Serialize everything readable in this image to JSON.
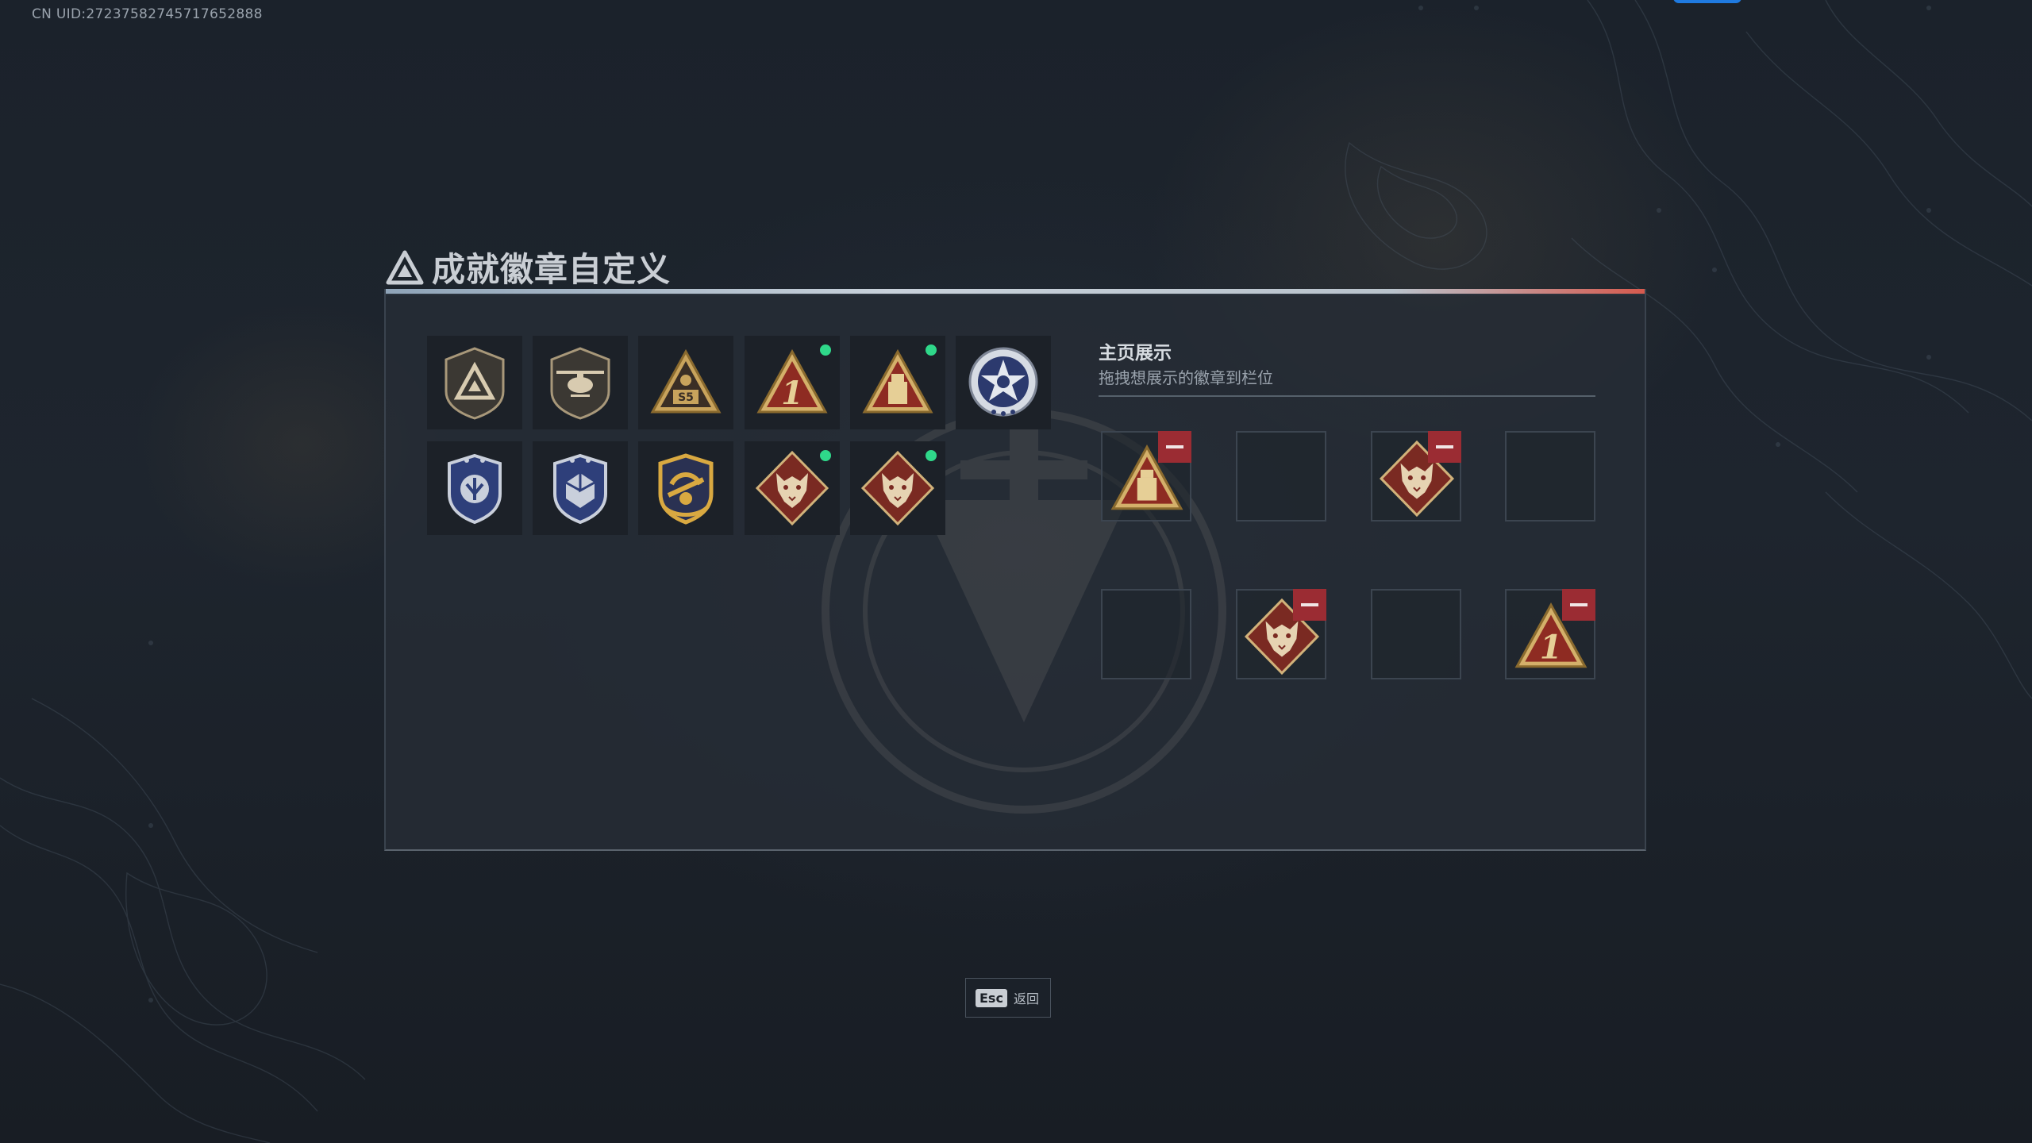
{
  "uid_text": "CN UID:2723758274571765288​8",
  "title": "成就徽章自定义",
  "title_tag": "",
  "colors": {
    "accent_red": "#9b2c33",
    "new_indicator": "#2fd88a",
    "top_button": "#1f7ae0"
  },
  "badges": [
    {
      "icon": "triangle-shield-badge-icon",
      "new": false
    },
    {
      "icon": "helicopter-badge-icon",
      "new": false
    },
    {
      "icon": "triangle-s5-badge-icon",
      "new": false
    },
    {
      "icon": "triangle-number-1-badge-icon",
      "new": true
    },
    {
      "icon": "triangle-tower-badge-icon",
      "new": true
    },
    {
      "icon": "star-wreath-badge-icon",
      "new": false
    },
    {
      "icon": "blue-shield-wings-badge-icon",
      "new": false
    },
    {
      "icon": "blue-shield-dice-badge-icon",
      "new": false
    },
    {
      "icon": "gold-shield-anchor-badge-icon",
      "new": false
    },
    {
      "icon": "wolf-diamond-badge-icon",
      "new": true
    },
    {
      "icon": "wolf-diamond-badge-icon",
      "new": true
    }
  ],
  "showcase": {
    "title": "主页展示",
    "subtitle": "拖拽想展示的徽章到栏位",
    "slots": [
      {
        "icon": "triangle-tower-badge-icon",
        "filled": true
      },
      {
        "icon": "",
        "filled": false
      },
      {
        "icon": "wolf-diamond-badge-icon",
        "filled": true
      },
      {
        "icon": "",
        "filled": false
      },
      {
        "icon": "",
        "filled": false
      },
      {
        "icon": "wolf-diamond-badge-icon",
        "filled": true
      },
      {
        "icon": "",
        "filled": false
      },
      {
        "icon": "triangle-number-1-badge-icon",
        "filled": true
      }
    ]
  },
  "footer": {
    "esc_key": "Esc",
    "esc_label": "返回"
  }
}
